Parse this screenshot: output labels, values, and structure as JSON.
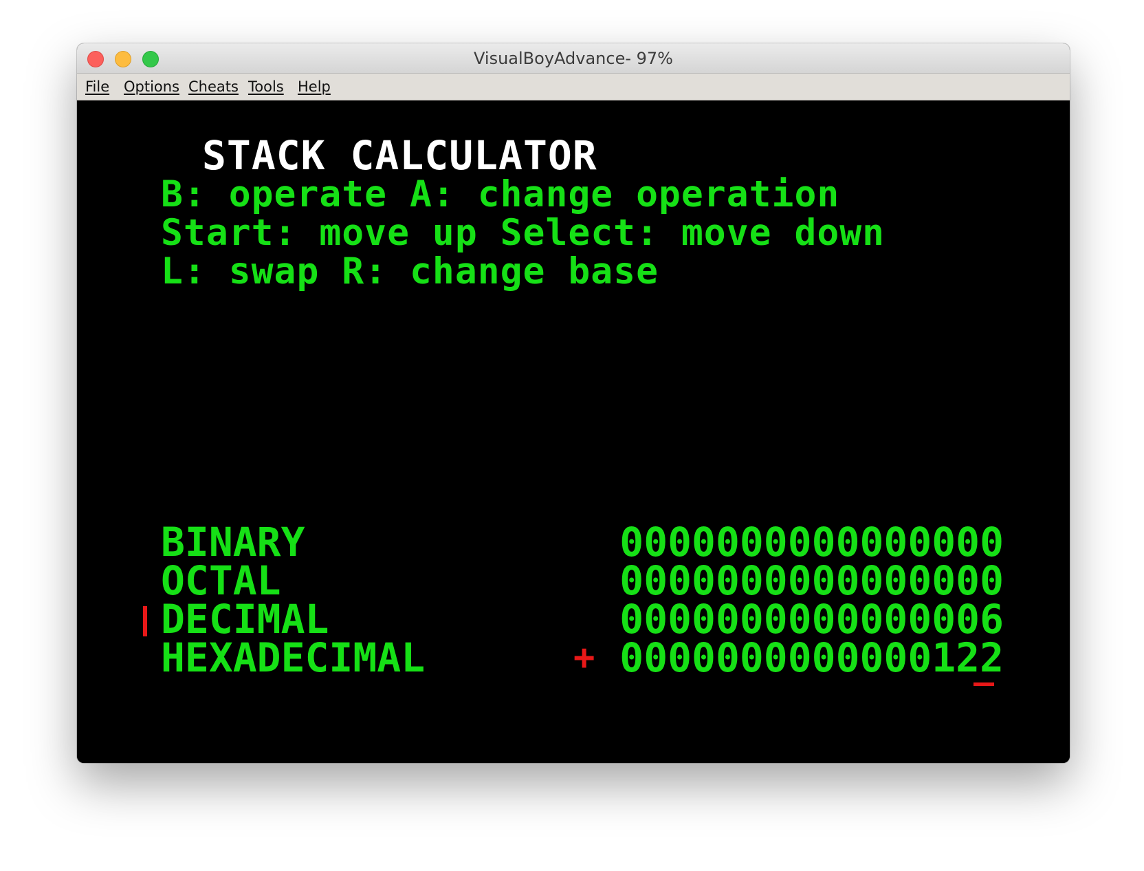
{
  "window": {
    "title": "VisualBoyAdvance- 97%"
  },
  "menu": {
    "items": [
      {
        "label": "File"
      },
      {
        "label": "Options"
      },
      {
        "label": "Cheats"
      },
      {
        "label": "Tools"
      },
      {
        "label": "Help"
      }
    ]
  },
  "game": {
    "title": "STACK CALCULATOR",
    "help_lines": [
      "B: operate A: change operation",
      "Start: move up Select: move down",
      "L: swap R: change base"
    ],
    "bases": [
      {
        "label": "BINARY",
        "value": "0000000000000000"
      },
      {
        "label": "OCTAL",
        "value": "0000000000000000"
      },
      {
        "label": "DECIMAL",
        "value": "0000000000000006"
      },
      {
        "label": "HEXADECIMAL",
        "value": "0000000000000122"
      }
    ],
    "sign": "+",
    "selected_base": "DECIMAL",
    "colors": {
      "background": "#000000",
      "title": "#ffffff",
      "text": "#16e016",
      "cursor": "#e81818"
    }
  }
}
